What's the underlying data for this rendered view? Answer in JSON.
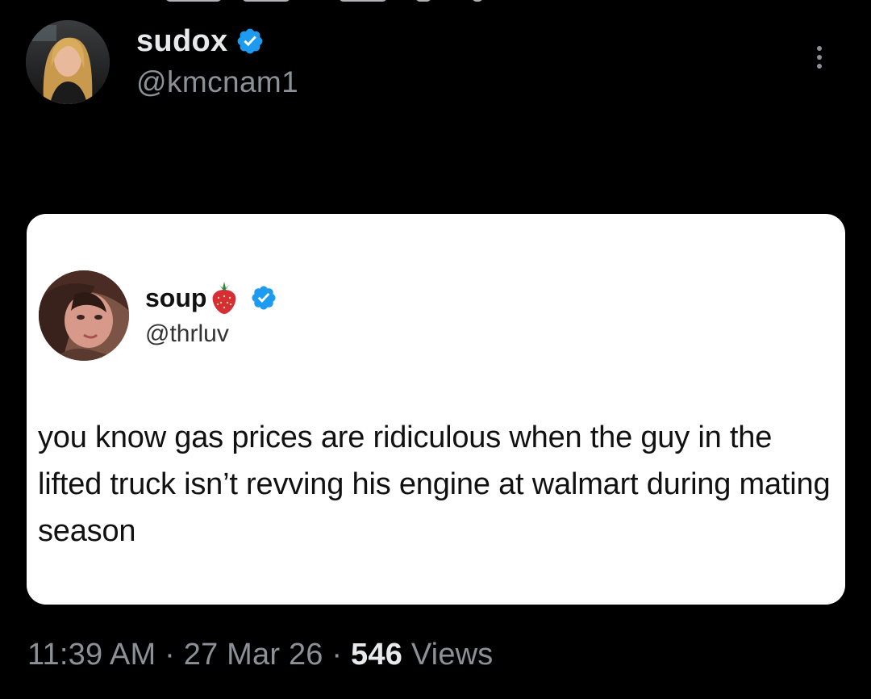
{
  "post": {
    "author": {
      "display_name": "sudox",
      "handle": "@kmcnam1",
      "verified": true,
      "verified_color": "#1d9bf0"
    },
    "more_icon": "more-vertical-icon",
    "media": {
      "quoted_author": {
        "display_name": "soup",
        "emoji": "strawberry",
        "handle": "@thrluv",
        "verified": true
      },
      "text": "you know gas prices are ridiculous when the guy in the lifted truck isn’t revving his engine at walmart during mating season"
    },
    "meta": {
      "time": "11:39 AM",
      "separator": "·",
      "date": "27 Mar 26",
      "views_count": "546",
      "views_label": "Views"
    }
  },
  "colors": {
    "background": "#000000",
    "primary_text": "#e7e9ea",
    "secondary_text": "#8b9196",
    "card_background": "#ffffff",
    "verified_blue": "#1d9bf0"
  }
}
